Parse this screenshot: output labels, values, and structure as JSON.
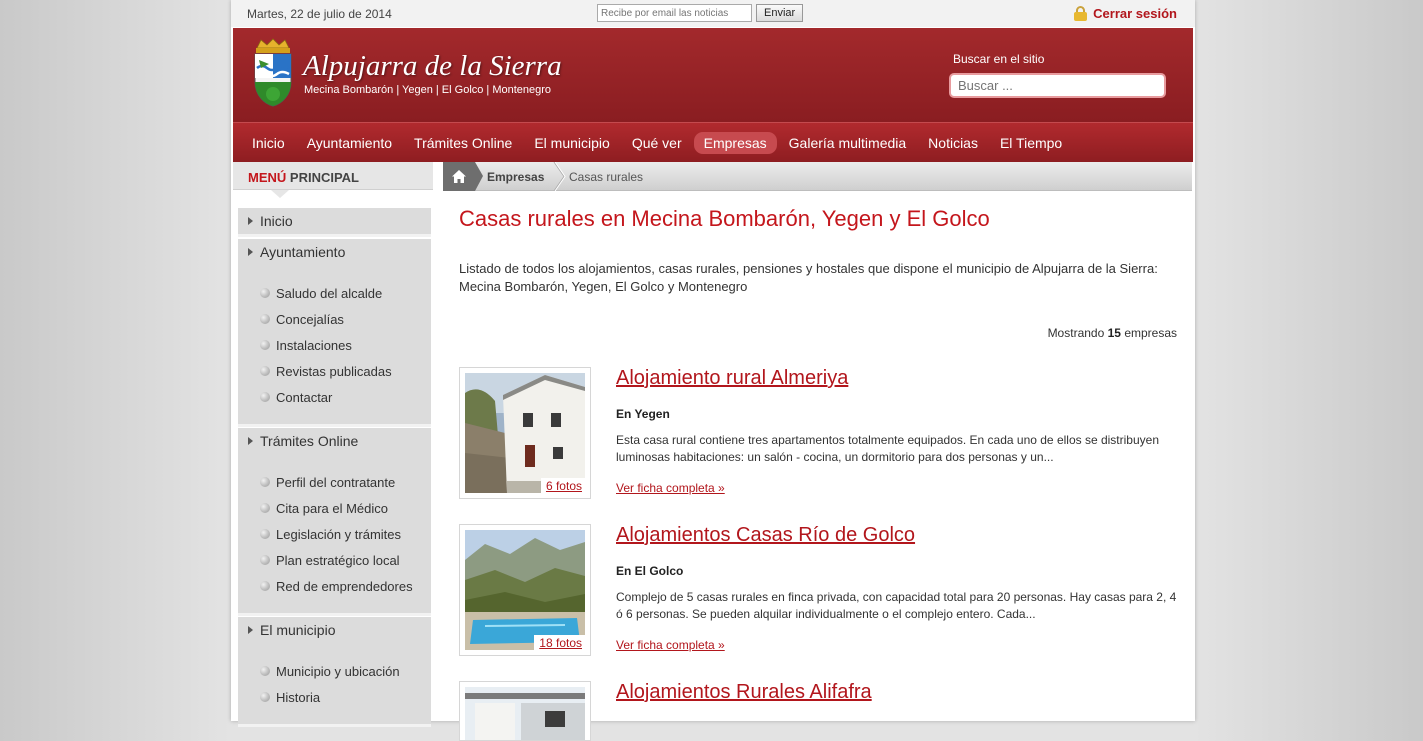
{
  "topbar": {
    "date": "Martes, 22 de julio de 2014",
    "newsletter_placeholder": "Recibe por email las noticias",
    "newsletter_button": "Enviar",
    "logout": "Cerrar sesión"
  },
  "header": {
    "title": "Alpujarra de la Sierra",
    "subtitle": "Mecina Bombarón | Yegen | El Golco | Montenegro",
    "search_label": "Buscar en el sitio",
    "search_placeholder": "Buscar ..."
  },
  "nav": {
    "items": [
      "Inicio",
      "Ayuntamiento",
      "Trámites Online",
      "El municipio",
      "Qué ver",
      "Empresas",
      "Galería multimedia",
      "Noticias",
      "El Tiempo"
    ],
    "active": "Empresas"
  },
  "sidebar": {
    "heading_red": "MENÚ",
    "heading_rest": "PRINCIPAL",
    "sections": [
      {
        "label": "Inicio",
        "items": []
      },
      {
        "label": "Ayuntamiento",
        "items": [
          "Saludo del alcalde",
          "Concejalías",
          "Instalaciones",
          "Revistas publicadas",
          "Contactar"
        ]
      },
      {
        "label": "Trámites Online",
        "items": [
          "Perfil del contratante",
          "Cita para el Médico",
          "Legislación y trámites",
          "Plan estratégico local",
          "Red de emprendedores"
        ]
      },
      {
        "label": "El municipio",
        "items": [
          "Municipio y ubicación",
          "Historia"
        ]
      }
    ]
  },
  "breadcrumb": {
    "level1": "Empresas",
    "level2": "Casas rurales"
  },
  "main": {
    "title": "Casas rurales en Mecina Bombarón, Yegen y El Golco",
    "intro": "Listado de todos los alojamientos, casas rurales, pensiones y hostales que dispone el municipio de Alpujarra de la Sierra: Mecina Bombarón, Yegen, El Golco y Montenegro",
    "count_prefix": "Mostrando",
    "count_value": "15",
    "count_suffix": "empresas",
    "more_label": "Ver ficha completa »",
    "listings": [
      {
        "title": "Alojamiento rural Almeriya",
        "location": "En Yegen",
        "description": "Esta casa rural contiene tres apartamentos totalmente equipados. En cada uno de ellos se distribuyen luminosas habitaciones: un salón - cocina, un dormitorio para dos personas y un...",
        "photos": "6 fotos"
      },
      {
        "title": "Alojamientos Casas Río de Golco",
        "location": "En El Golco",
        "description": "Complejo de 5 casas rurales en finca privada, con capacidad total para 20 personas. Hay casas para 2, 4 ó 6 personas. Se pueden alquilar individualmente o el complejo entero. Cada...",
        "photos": "18 fotos"
      },
      {
        "title": "Alojamientos Rurales Alifafra",
        "location": "",
        "description": "",
        "photos": ""
      }
    ]
  }
}
